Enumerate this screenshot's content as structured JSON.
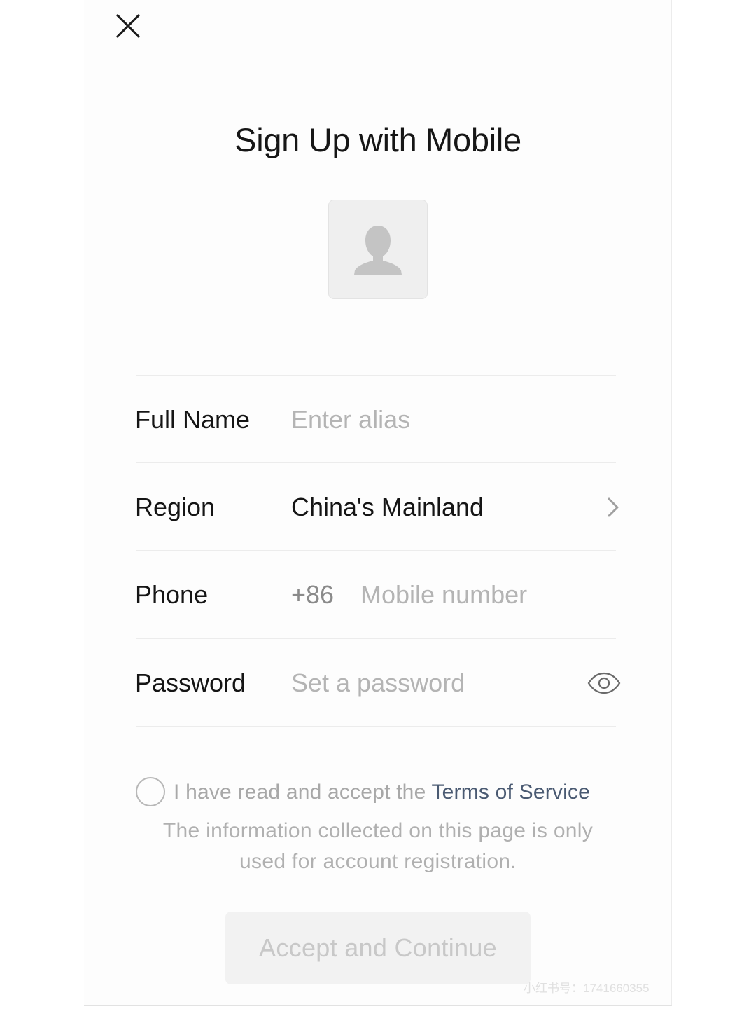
{
  "title": "Sign Up with Mobile",
  "icons": {
    "close": "close-icon",
    "avatar": "person-silhouette-icon",
    "region_chevron": "chevron-right-icon",
    "password_toggle": "eye-icon"
  },
  "form": {
    "full_name": {
      "label": "Full Name",
      "placeholder": "Enter alias"
    },
    "region": {
      "label": "Region",
      "value": "China's Mainland"
    },
    "phone": {
      "label": "Phone",
      "country_code": "+86",
      "placeholder": "Mobile number"
    },
    "password": {
      "label": "Password",
      "placeholder": "Set a password"
    }
  },
  "consent": {
    "checked": false,
    "text": "I have read and accept the ",
    "link": "Terms of Service"
  },
  "info": "The information collected on this page is only used for account registration.",
  "accept_button": {
    "label": "Accept and Continue",
    "enabled": false
  },
  "watermark": "小红书号：1741660355",
  "colors": {
    "text_primary": "#151515",
    "placeholder": "#b4b4b4",
    "link": "#4a5a72",
    "button_disabled_bg": "#f2f2f2",
    "button_disabled_text": "#c8c8c8"
  }
}
